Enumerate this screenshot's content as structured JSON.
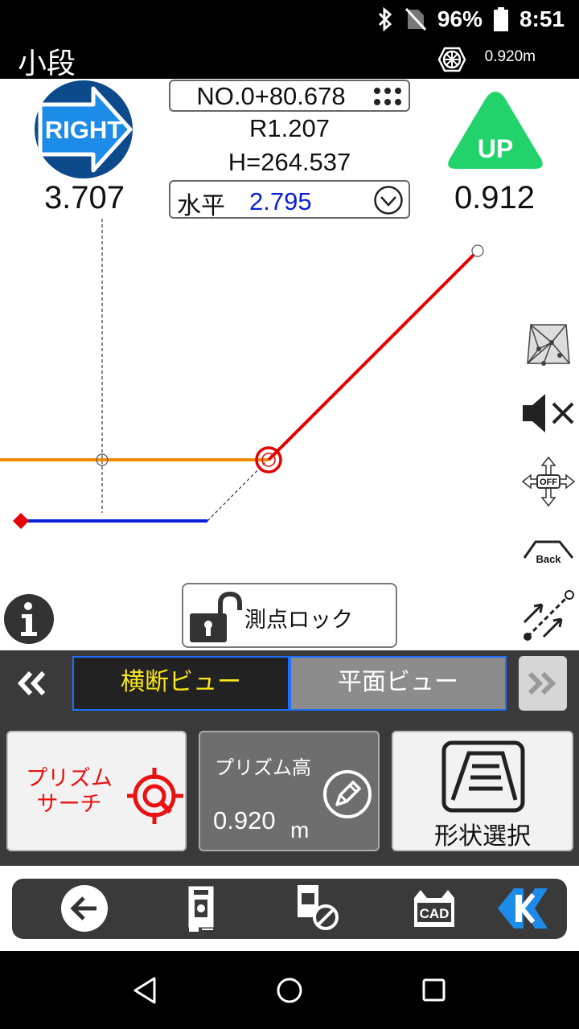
{
  "status_bar": {
    "battery": "96%",
    "time": "8:51"
  },
  "title_bar": {
    "title": "小段",
    "prism_height": "0.920m"
  },
  "direction": {
    "label": "RIGHT",
    "value": "3.707"
  },
  "vertical": {
    "label": "UP",
    "value": "0.912"
  },
  "station": {
    "no": "NO.0+80.678",
    "r": "R1.207",
    "h": "H=264.537"
  },
  "mode": {
    "label": "水平",
    "value": "2.795"
  },
  "lock_button": {
    "label": "測点ロック"
  },
  "tabs": {
    "cross": "横断ビュー",
    "plan": "平面ビュー"
  },
  "prism_search": {
    "label_line1": "プリズム",
    "label_line2": "サーチ"
  },
  "prism_height": {
    "label": "プリズム高",
    "value": "0.920",
    "unit": "m"
  },
  "shape_select": {
    "label": "形状選択"
  },
  "tools": {
    "back_label": "Back",
    "move_label": "OFF",
    "cad_label": "CAD"
  },
  "colors": {
    "orange": "#f08a00",
    "red": "#e60000",
    "blue": "#0a1ed8",
    "green": "#22d36c",
    "navy": "#0c4a8c"
  }
}
